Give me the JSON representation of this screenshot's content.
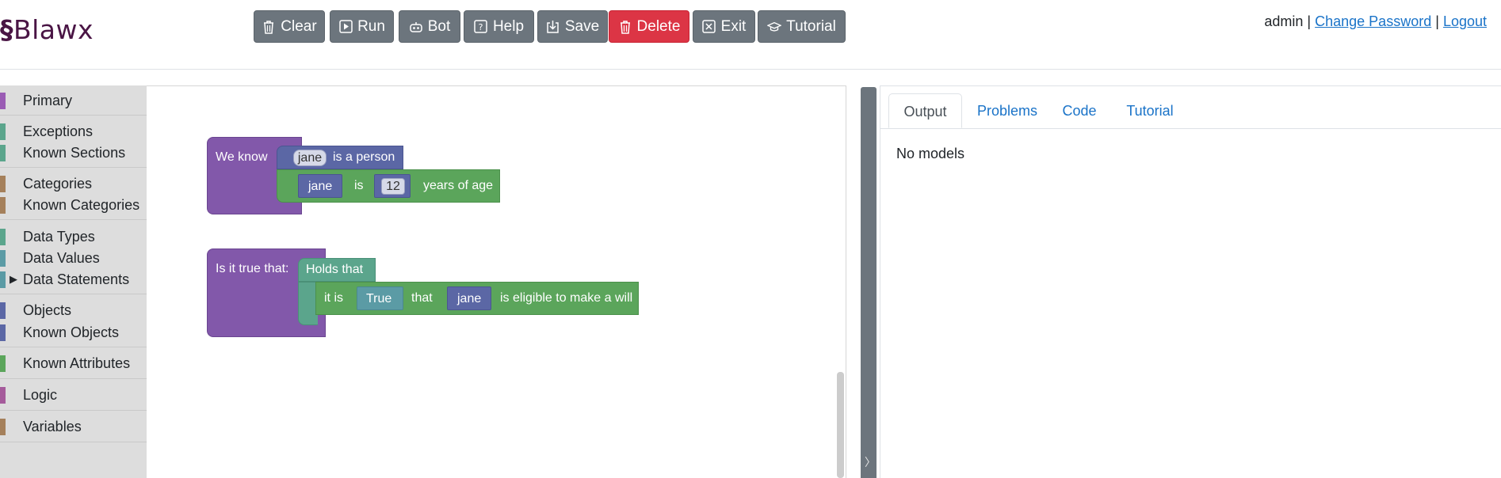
{
  "app": {
    "logo_mark": "§",
    "logo_text": "Blawx"
  },
  "toolbar": {
    "clear": "Clear",
    "run": "Run",
    "bot": "Bot",
    "help": "Help",
    "save": "Save",
    "delete": "Delete",
    "exit": "Exit",
    "tutorial": "Tutorial"
  },
  "user": {
    "name": "admin",
    "separator": "|",
    "change_password": "Change Password",
    "logout": "Logout"
  },
  "colors": {
    "accent_danger": "#dc3545",
    "button_gray": "#6c757d",
    "link": "#1a73c8"
  },
  "toolbox": {
    "categories": [
      {
        "label": "Primary",
        "color": "#9a5cb4"
      },
      {
        "label": "Exceptions",
        "color": "#5ba58c"
      },
      {
        "label": "Known Sections",
        "color": "#5ba58c"
      },
      {
        "label": "Categories",
        "color": "#a5805b"
      },
      {
        "label": "Known Categories",
        "color": "#a5805b"
      },
      {
        "label": "Data Types",
        "color": "#5ba58c"
      },
      {
        "label": "Data Values",
        "color": "#5b9ba5"
      },
      {
        "label": "Data Statements",
        "color": "#5b9ba5",
        "expanded_marker": "▶"
      },
      {
        "label": "Objects",
        "color": "#5b67a5"
      },
      {
        "label": "Known Objects",
        "color": "#5b67a5"
      },
      {
        "label": "Known Attributes",
        "color": "#5ba55b"
      },
      {
        "label": "Logic",
        "color": "#a55b9b"
      },
      {
        "label": "Variables",
        "color": "#a5805b"
      }
    ]
  },
  "workspace": {
    "fact_block": {
      "label": "We know",
      "statement1": {
        "object": "jane",
        "text": "is a person"
      },
      "statement2": {
        "object": "jane",
        "is": "is",
        "value": "12",
        "suffix": "years of age"
      }
    },
    "query_block": {
      "label": "Is it true that:",
      "holds": "Holds that",
      "row": {
        "it_is": "it is",
        "bool": "True",
        "that": "that",
        "object": "jane",
        "suffix": "is eligible to make a will"
      }
    }
  },
  "splitter": {
    "chevron": "〉"
  },
  "panel": {
    "tabs": [
      "Output",
      "Problems",
      "Code",
      "Tutorial"
    ],
    "active_tab": "Output",
    "body": "No models"
  }
}
